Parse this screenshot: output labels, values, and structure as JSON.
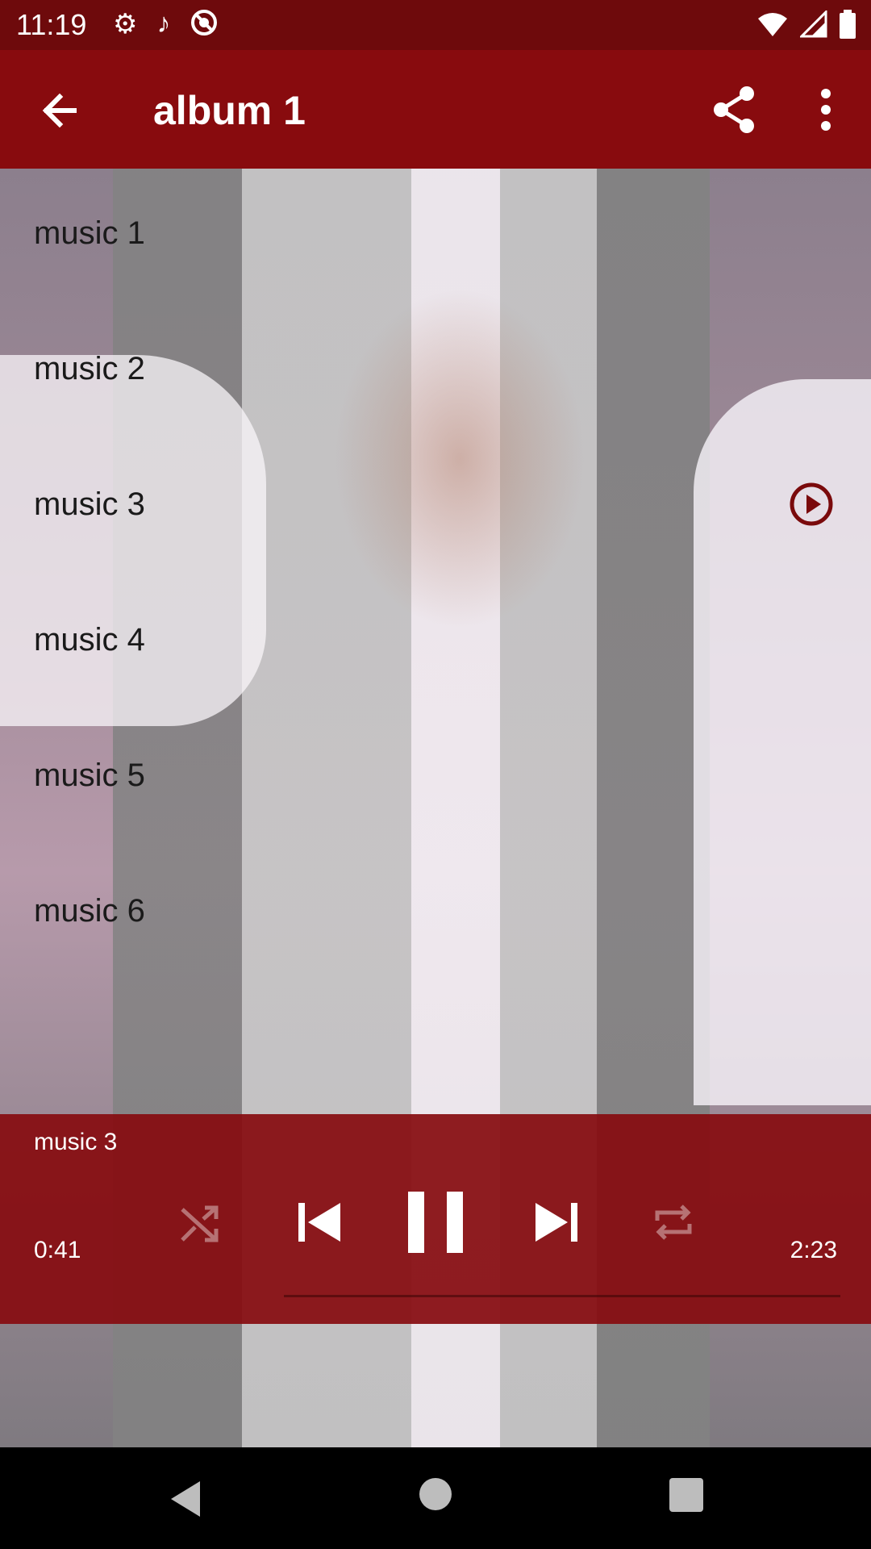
{
  "status_bar": {
    "time": "11:19",
    "left_icons": [
      "settings-icon",
      "music-note-icon",
      "location-off-icon"
    ],
    "right_icons": [
      "wifi-icon",
      "signal-icon",
      "battery-icon"
    ]
  },
  "app_bar": {
    "title": "album 1",
    "back_icon": "arrow-back-icon",
    "share_icon": "share-icon",
    "more_icon": "more-vert-icon",
    "color": "#880b0e"
  },
  "tracks": [
    {
      "label": "music 1",
      "playing": false
    },
    {
      "label": "music 2",
      "playing": false
    },
    {
      "label": "music 3",
      "playing": true
    },
    {
      "label": "music 4",
      "playing": false
    },
    {
      "label": "music 5",
      "playing": false
    },
    {
      "label": "music 6",
      "playing": false
    }
  ],
  "player": {
    "now_playing": "music 3",
    "current_time": "0:41",
    "total_time": "2:23",
    "controls": [
      "shuffle-icon",
      "skip-previous-icon",
      "pause-icon",
      "skip-next-icon",
      "repeat-icon"
    ],
    "color": "#870c10"
  },
  "nav_bar": {
    "buttons": [
      "nav-back-icon",
      "nav-home-icon",
      "nav-recents-icon"
    ]
  }
}
